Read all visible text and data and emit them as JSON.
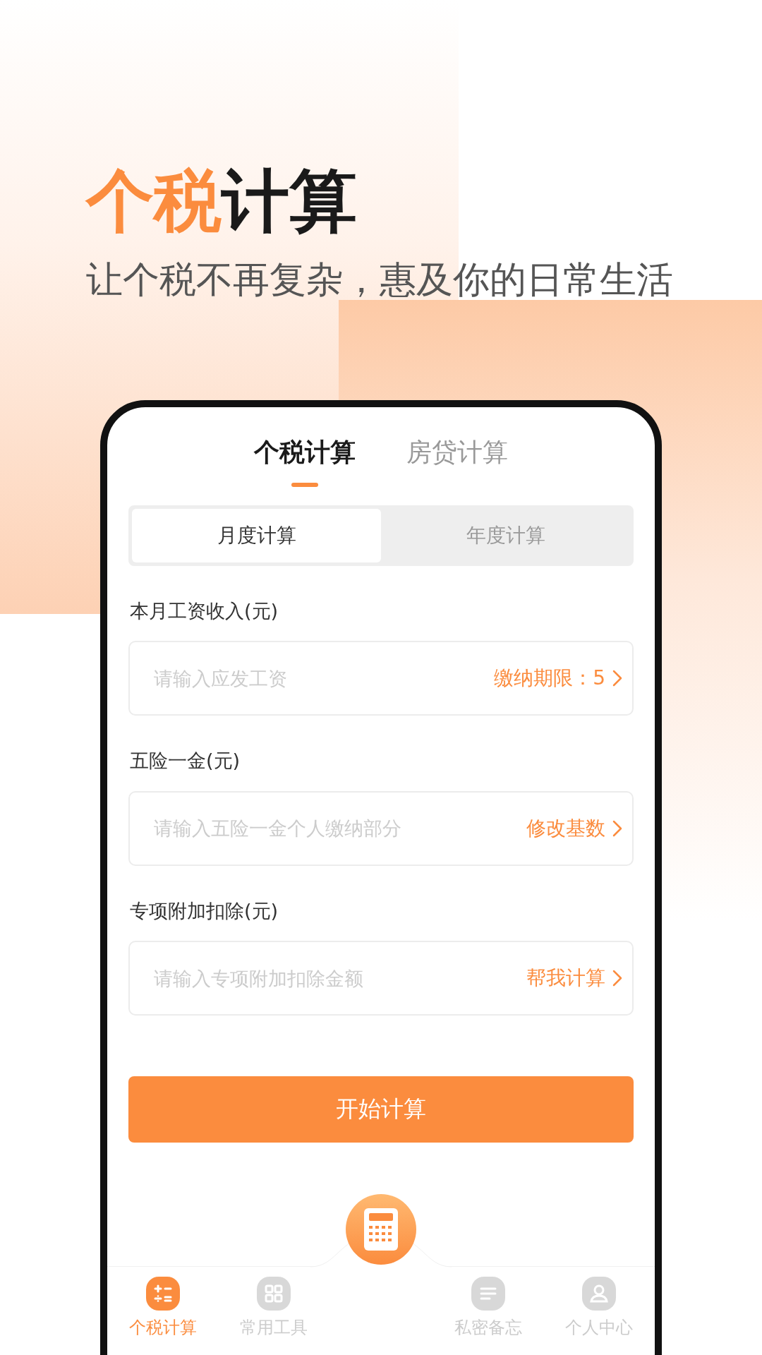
{
  "headline": {
    "highlight": "个税",
    "rest": "计算"
  },
  "subtitle": "让个税不再复杂，惠及你的日常生活",
  "tabs": [
    {
      "label": "个税计算",
      "selected": true
    },
    {
      "label": "房贷计算",
      "selected": false
    }
  ],
  "period": [
    {
      "label": "月度计算",
      "selected": true
    },
    {
      "label": "年度计算",
      "selected": false
    }
  ],
  "fields": [
    {
      "label": "本月工资收入(元)",
      "placeholder": "请输入应发工资",
      "action": "缴纳期限：5"
    },
    {
      "label": "五险一金(元)",
      "placeholder": "请输入五险一金个人缴纳部分",
      "action": "修改基数"
    },
    {
      "label": "专项附加扣除(元)",
      "placeholder": "请输入专项附加扣除金额",
      "action": "帮我计算"
    }
  ],
  "submit": "开始计算",
  "nav": [
    {
      "kind": "math",
      "label": "个税计算",
      "selected": true
    },
    {
      "kind": "grid",
      "label": "常用工具",
      "selected": false
    },
    {
      "kind": "center"
    },
    {
      "kind": "notes",
      "label": "私密备忘",
      "selected": false
    },
    {
      "kind": "person",
      "label": "个人中心",
      "selected": false
    }
  ]
}
